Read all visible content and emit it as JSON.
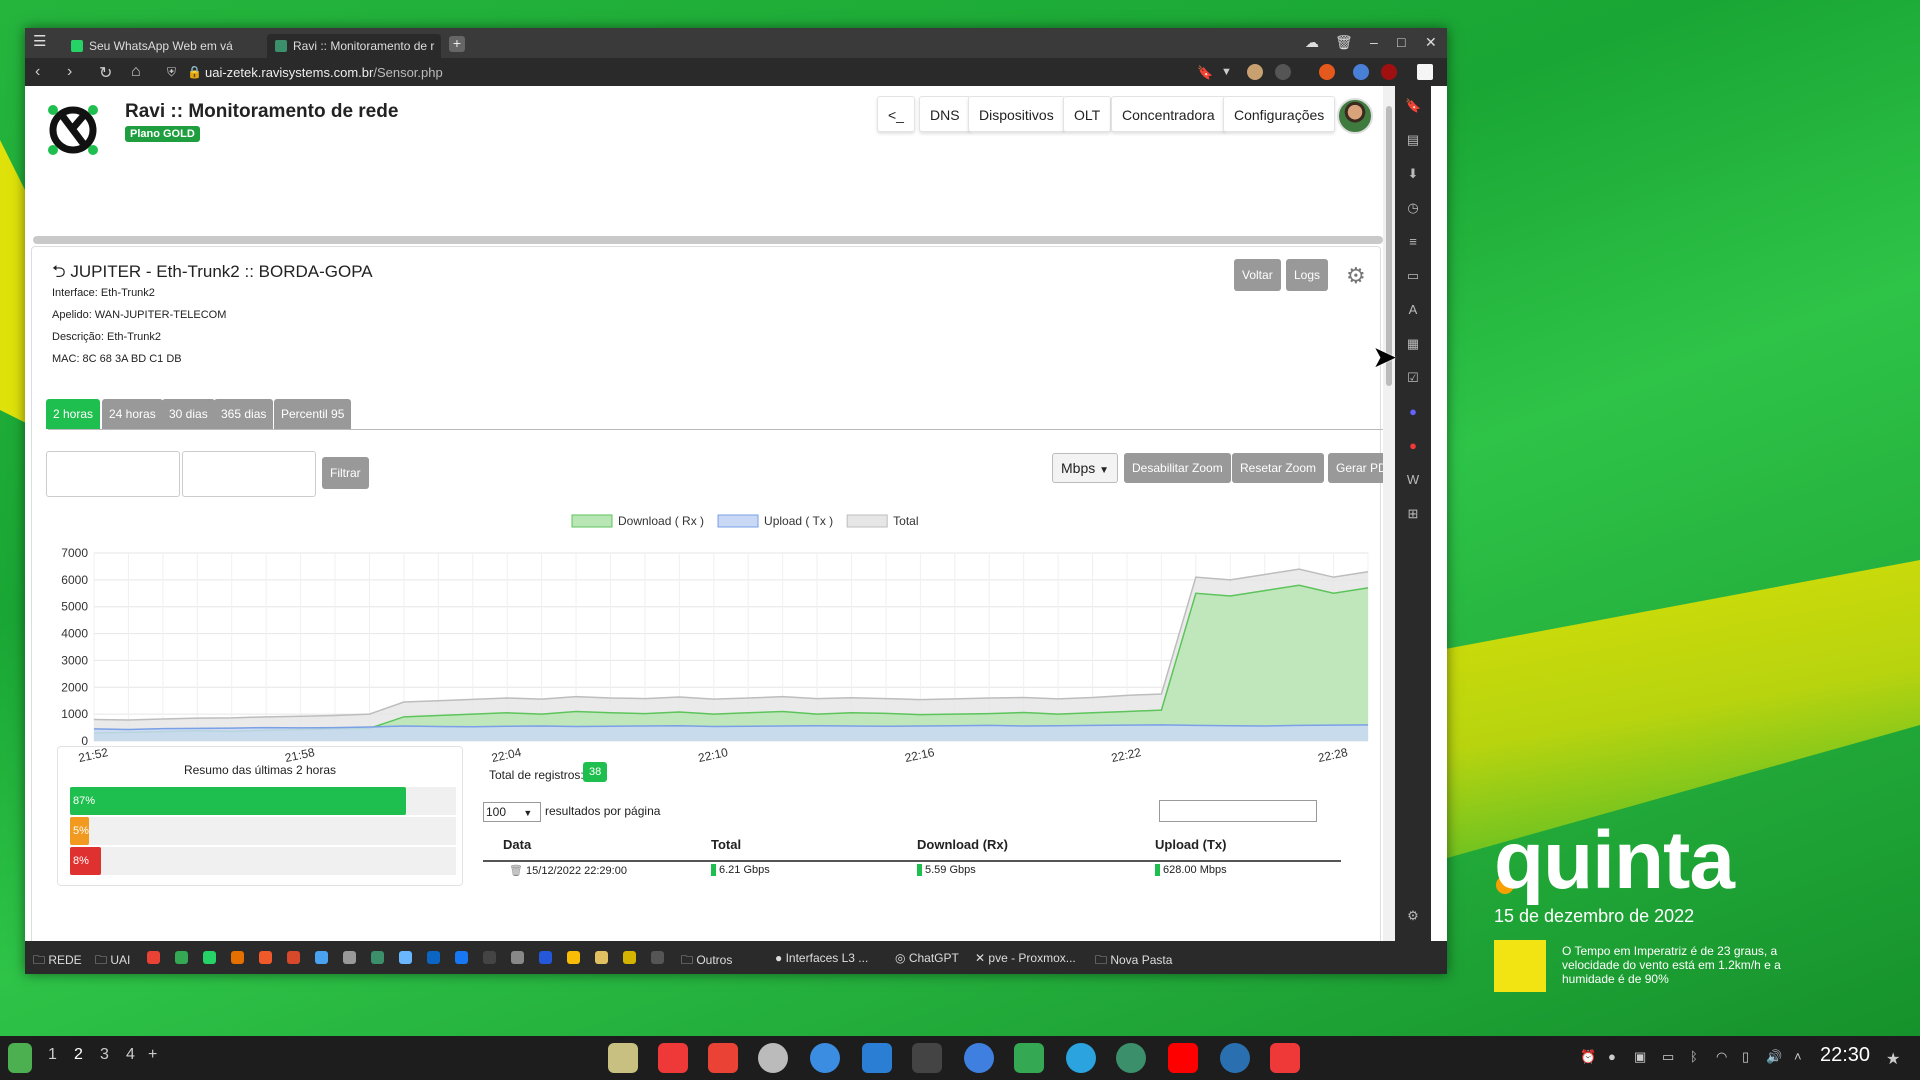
{
  "browser": {
    "tabs": [
      {
        "label": "Seu WhatsApp Web em vá"
      },
      {
        "label": "Ravi :: Monitoramento de r"
      }
    ],
    "url_host": "uai-zetek.ravisystems.com.br",
    "url_path": "/Sensor.php"
  },
  "header": {
    "title": "Ravi :: Monitoramento de rede",
    "plan": "Plano GOLD",
    "nav": [
      "<_",
      "DNS",
      "Dispositivos",
      "OLT",
      "Concentradora",
      "Configurações"
    ]
  },
  "sensor": {
    "title": "JUPITER - Eth-Trunk2 :: BORDA-GOPA",
    "interface": "Interface: Eth-Trunk2",
    "apelido": "Apelido: WAN-JUPITER-TELECOM",
    "descricao": "Descrição: Eth-Trunk2",
    "mac": "MAC: 8C 68 3A BD C1 DB",
    "back_label": "Voltar",
    "logs_label": "Logs"
  },
  "period_tabs": [
    "2 horas",
    "24 horas",
    "30 dias",
    "365 dias",
    "Percentil 95"
  ],
  "filter_label": "Filtrar",
  "unit_select": "Mbps",
  "actions": {
    "disable_zoom": "Desabilitar Zoom",
    "reset_zoom": "Resetar Zoom",
    "pdf": "Gerar PDF"
  },
  "chart_data": {
    "type": "area",
    "x": [
      "21:52",
      "21:53",
      "21:54",
      "21:55",
      "21:56",
      "21:57",
      "21:58",
      "21:59",
      "22:00",
      "22:01",
      "22:02",
      "22:03",
      "22:04",
      "22:05",
      "22:06",
      "22:07",
      "22:08",
      "22:09",
      "22:10",
      "22:11",
      "22:12",
      "22:13",
      "22:14",
      "22:15",
      "22:16",
      "22:17",
      "22:18",
      "22:19",
      "22:20",
      "22:21",
      "22:22",
      "22:23",
      "22:24",
      "22:25",
      "22:26",
      "22:27",
      "22:28",
      "22:29"
    ],
    "xticks": [
      "21:52",
      "21:58",
      "22:04",
      "22:10",
      "22:16",
      "22:22",
      "22:28"
    ],
    "series": [
      {
        "name": "Download ( Rx )",
        "color": "#b8e6b4",
        "values": [
          300,
          320,
          350,
          380,
          360,
          400,
          420,
          450,
          470,
          900,
          950,
          1000,
          1050,
          1000,
          1100,
          1050,
          1020,
          1080,
          1000,
          1050,
          1100,
          1000,
          1050,
          1030,
          980,
          1000,
          1020,
          1060,
          1000,
          1050,
          1100,
          1150,
          5500,
          5400,
          5600,
          5800,
          5500,
          5700
        ]
      },
      {
        "name": "Upload ( Tx )",
        "color": "#c8d8f5",
        "values": [
          450,
          430,
          460,
          470,
          480,
          500,
          490,
          500,
          520,
          560,
          540,
          530,
          550,
          560,
          540,
          550,
          560,
          570,
          540,
          550,
          560,
          570,
          560,
          550,
          560,
          570,
          580,
          560,
          570,
          580,
          590,
          600,
          580,
          570,
          560,
          580,
          590,
          600
        ]
      },
      {
        "name": "Total",
        "color": "#e6e6e6",
        "values": [
          800,
          780,
          820,
          850,
          860,
          900,
          920,
          950,
          1000,
          1450,
          1500,
          1550,
          1600,
          1560,
          1650,
          1600,
          1580,
          1640,
          1560,
          1600,
          1650,
          1580,
          1610,
          1580,
          1540,
          1570,
          1600,
          1620,
          1570,
          1620,
          1700,
          1750,
          6100,
          6000,
          6200,
          6400,
          6100,
          6300
        ]
      }
    ],
    "yticks": [
      0,
      1000,
      2000,
      3000,
      4000,
      5000,
      6000,
      7000
    ],
    "ylim": [
      0,
      7000
    ],
    "legend": "top-center",
    "grid": true
  },
  "summary": {
    "title": "Resumo das últimas 2 horas",
    "bars": [
      {
        "label": "87%",
        "value": 87,
        "color": "#1fbf4f"
      },
      {
        "label": "5%",
        "value": 5,
        "color": "#f29a1f"
      },
      {
        "label": "8%",
        "value": 8,
        "color": "#e03131"
      }
    ]
  },
  "records": {
    "total_label": "Total de registros:",
    "total": "38",
    "per_page": "100",
    "per_page_label": "resultados por página",
    "columns": [
      "Data",
      "Total",
      "Download (Rx)",
      "Upload (Tx)"
    ],
    "rows": [
      [
        "15/12/2022 22:29:00",
        "6.21 Gbps",
        "5.59 Gbps",
        "628.00 Mbps"
      ]
    ]
  },
  "bookmarks": [
    "REDE",
    "UAI",
    "Outros",
    "Interfaces L3 ...",
    "ChatGPT",
    "pve - Proxmox...",
    "Nova Pasta"
  ],
  "desktop": {
    "day": "quinta",
    "date": "15 de dezembro de 2022",
    "weather": "O Tempo em Imperatriz é de 23 graus, a velocidade do vento está em 1.2km/h e a humidade é de 90%"
  },
  "taskbar": {
    "workspaces": [
      "1",
      "2",
      "3",
      "4",
      "+"
    ],
    "clock": "22:30"
  }
}
